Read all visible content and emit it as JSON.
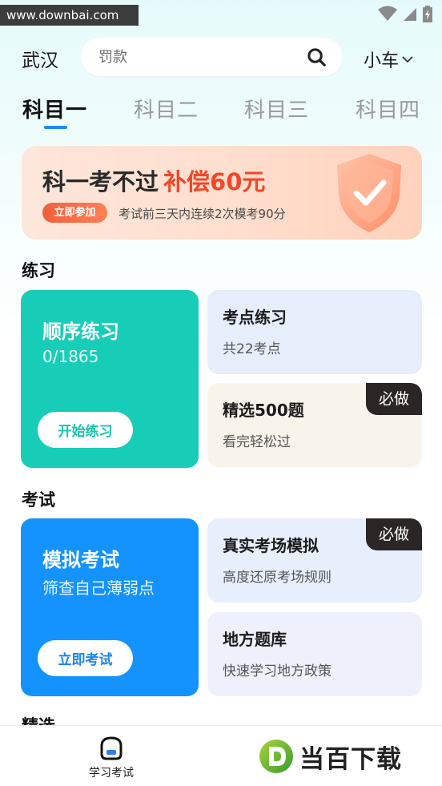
{
  "status_bar": {
    "watermark": "www.downbai.com"
  },
  "header": {
    "city": "武汉",
    "search_placeholder": "罚款",
    "vehicle": "小车"
  },
  "tabs": [
    {
      "label": "科目一",
      "active": true
    },
    {
      "label": "科目二",
      "active": false
    },
    {
      "label": "科目三",
      "active": false
    },
    {
      "label": "科目四",
      "active": false
    }
  ],
  "banner": {
    "title": "科一考不过",
    "highlight": "补偿60元",
    "join_label": "立即参加",
    "subtitle": "考试前三天内连续2次模考90分"
  },
  "practice": {
    "section_title": "练习",
    "sequential": {
      "title": "顺序练习",
      "progress": "0/1865",
      "button": "开始练习"
    },
    "points": {
      "title": "考点练习",
      "subtitle": "共22考点"
    },
    "selected": {
      "title": "精选500题",
      "subtitle": "看完轻松过",
      "badge": "必做"
    }
  },
  "exam": {
    "section_title": "考试",
    "mock": {
      "title": "模拟考试",
      "subtitle": "筛查自己薄弱点",
      "button": "立即考试"
    },
    "real": {
      "title": "真实考场模拟",
      "subtitle": "高度还原考场规则",
      "badge": "必做"
    },
    "local": {
      "title": "地方题库",
      "subtitle": "快速学习地方政策"
    }
  },
  "featured": {
    "section_title": "精选"
  },
  "bottom_nav": {
    "study_label": "学习考试"
  },
  "brand": {
    "logo_text": "当百下载"
  },
  "colors": {
    "accent_blue": "#1f8bff",
    "teal": "#18cdb8",
    "exam_blue": "#1493ff",
    "banner_red": "#f24729"
  }
}
